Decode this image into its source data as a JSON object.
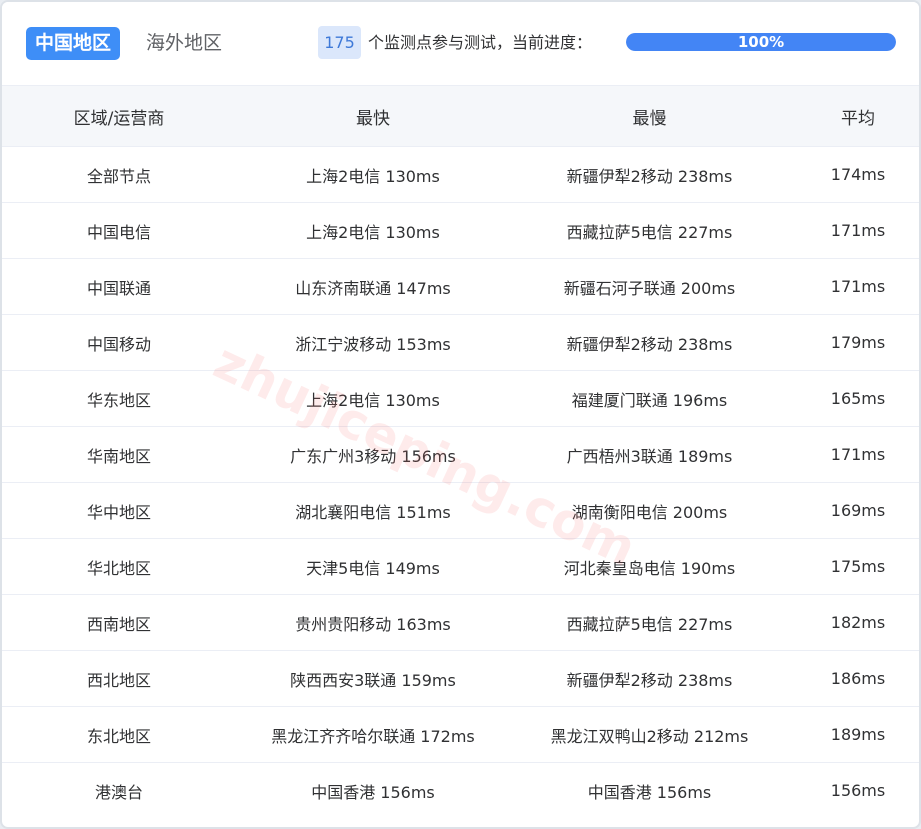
{
  "tabs": [
    {
      "label": "中国地区",
      "active": true
    },
    {
      "label": "海外地区",
      "active": false
    }
  ],
  "status": {
    "node_count": "175",
    "text": "个监测点参与测试，当前进度：",
    "progress_label": "100%",
    "progress_value": 1.0
  },
  "table": {
    "headers": [
      "区域/运营商",
      "最快",
      "最慢",
      "平均"
    ],
    "rows": [
      [
        "全部节点",
        "上海2电信 130ms",
        "新疆伊犁2移动 238ms",
        "174ms"
      ],
      [
        "中国电信",
        "上海2电信 130ms",
        "西藏拉萨5电信 227ms",
        "171ms"
      ],
      [
        "中国联通",
        "山东济南联通 147ms",
        "新疆石河子联通 200ms",
        "171ms"
      ],
      [
        "中国移动",
        "浙江宁波移动 153ms",
        "新疆伊犁2移动 238ms",
        "179ms"
      ],
      [
        "华东地区",
        "上海2电信 130ms",
        "福建厦门联通 196ms",
        "165ms"
      ],
      [
        "华南地区",
        "广东广州3移动 156ms",
        "广西梧州3联通 189ms",
        "171ms"
      ],
      [
        "华中地区",
        "湖北襄阳电信 151ms",
        "湖南衡阳电信 200ms",
        "169ms"
      ],
      [
        "华北地区",
        "天津5电信 149ms",
        "河北秦皇岛电信 190ms",
        "175ms"
      ],
      [
        "西南地区",
        "贵州贵阳移动 163ms",
        "西藏拉萨5电信 227ms",
        "182ms"
      ],
      [
        "西北地区",
        "陕西西安3联通 159ms",
        "新疆伊犁2移动 238ms",
        "186ms"
      ],
      [
        "东北地区",
        "黑龙江齐齐哈尔联通 172ms",
        "黑龙江双鸭山2移动 212ms",
        "189ms"
      ],
      [
        "港澳台",
        "中国香港 156ms",
        "中国香港 156ms",
        "156ms"
      ]
    ]
  },
  "watermark": "zhujiceping.com",
  "colors": {
    "accent": "#3e8ef7",
    "progress": "#4385f5",
    "header_bg": "#f5f7fa"
  }
}
